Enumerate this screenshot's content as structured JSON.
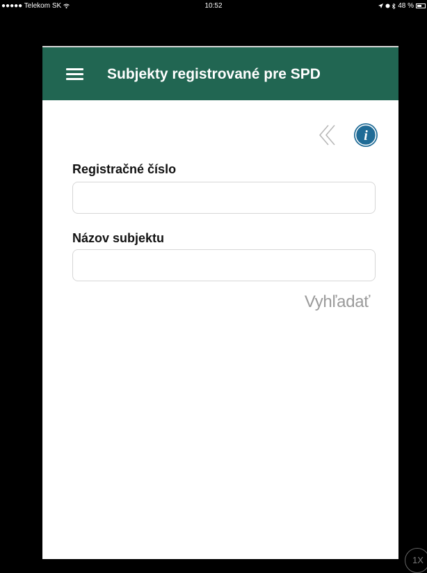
{
  "status_bar": {
    "carrier": "●●●●● Telekom SK",
    "wifi_icon": "wifi-icon",
    "time": "10:52",
    "battery_percent": "48 %"
  },
  "header": {
    "title": "Subjekty registrované pre SPD",
    "background": "#216652",
    "menu_icon": "hamburger-menu-icon"
  },
  "toolbar": {
    "back_icon": "double-chevron-left-icon",
    "info_icon": "info-icon",
    "info_color": "#1f6b96"
  },
  "form": {
    "registration_number": {
      "label": "Registračné číslo",
      "value": "",
      "placeholder": ""
    },
    "subject_name": {
      "label": "Názov subjektu",
      "value": "",
      "placeholder": ""
    },
    "search_label": "Vyhľadať"
  },
  "zoom_badge": "1X"
}
